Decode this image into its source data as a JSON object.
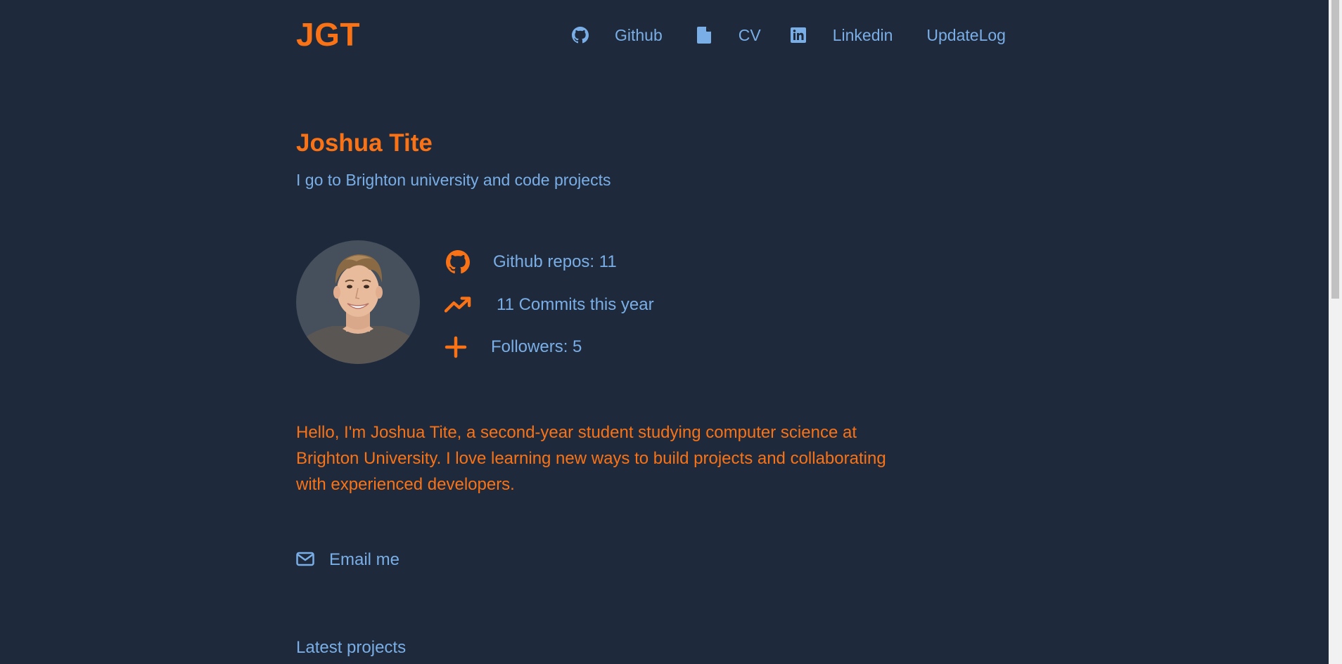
{
  "header": {
    "logo": "JGT",
    "nav": [
      {
        "icon": "github-icon",
        "label": "Github"
      },
      {
        "icon": "document-icon",
        "label": "CV"
      },
      {
        "icon": "linkedin-icon",
        "label": "Linkedin"
      },
      {
        "label": "UpdateLog"
      }
    ]
  },
  "profile": {
    "name": "Joshua Tite",
    "tagline": "I go to Brighton university and code projects",
    "stats": [
      {
        "icon": "github-icon",
        "text": "Github repos: 11"
      },
      {
        "icon": "trending-up-icon",
        "text": "11 Commits this year"
      },
      {
        "icon": "plus-icon",
        "text": "Followers: 5"
      }
    ],
    "bio": "Hello, I'm Joshua Tite, a second-year student studying computer science at Brighton University. I love learning new ways to build projects and collaborating with experienced developers."
  },
  "contact": {
    "icon": "envelope-icon",
    "label": "Email me"
  },
  "projects": {
    "heading": "Latest projects"
  },
  "colors": {
    "background": "#1e293b",
    "accent": "#f97316",
    "link": "#7aaee6"
  }
}
